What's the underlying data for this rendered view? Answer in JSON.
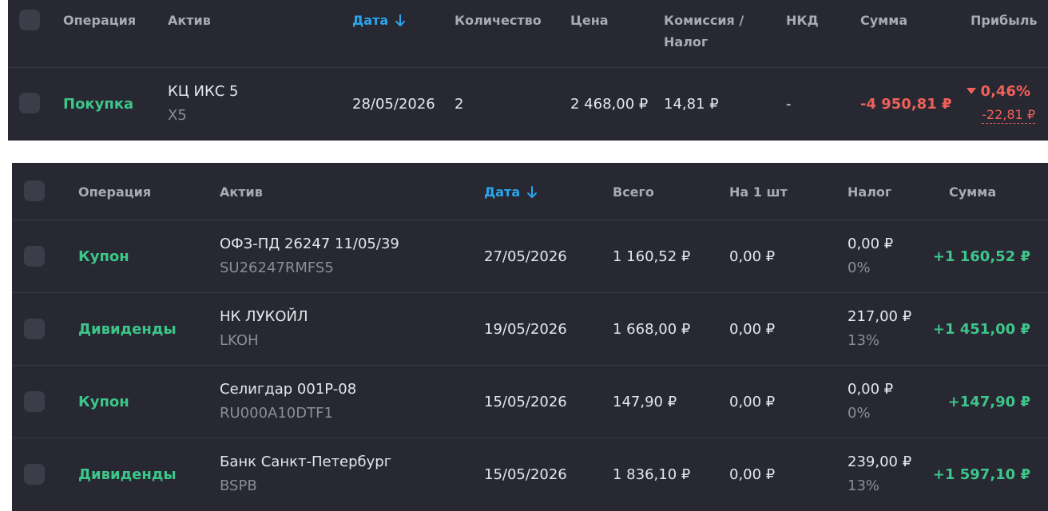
{
  "trades": {
    "headers": {
      "operation": "Операция",
      "asset": "Актив",
      "date": "Дата",
      "quantity": "Количество",
      "price": "Цена",
      "commission_line1": "Комиссия /",
      "commission_line2": "Налог",
      "nkd": "НКД",
      "sum": "Сумма",
      "profit": "Прибыль"
    },
    "rows": [
      {
        "operation": "Покупка",
        "asset_name": "КЦ ИКС 5",
        "asset_ticker": "X5",
        "date": "28/05/2026",
        "quantity": "2",
        "price": "2 468,00 ₽",
        "commission": "14,81 ₽",
        "nkd": "-",
        "sum": "-4 950,81 ₽",
        "profit_percent": "0,46%",
        "profit_amount": "-22,81 ₽"
      }
    ]
  },
  "payouts": {
    "headers": {
      "operation": "Операция",
      "asset": "Актив",
      "date": "Дата",
      "total": "Всего",
      "per_share": "На 1 шт",
      "tax": "Налог",
      "sum": "Сумма"
    },
    "rows": [
      {
        "operation": "Купон",
        "asset_name": "ОФЗ-ПД 26247 11/05/39",
        "asset_ticker": "SU26247RMFS5",
        "date": "27/05/2026",
        "total": "1 160,52 ₽",
        "per_share": "0,00 ₽",
        "tax": "0,00 ₽",
        "tax_rate": "0%",
        "sum": "+1 160,52 ₽"
      },
      {
        "operation": "Дивиденды",
        "asset_name": "НК ЛУКОЙЛ",
        "asset_ticker": "LKOH",
        "date": "19/05/2026",
        "total": "1 668,00 ₽",
        "per_share": "0,00 ₽",
        "tax": "217,00 ₽",
        "tax_rate": "13%",
        "sum": "+1 451,00 ₽"
      },
      {
        "operation": "Купон",
        "asset_name": "Селигдар 001P-08",
        "asset_ticker": "RU000A10DTF1",
        "date": "15/05/2026",
        "total": "147,90 ₽",
        "per_share": "0,00 ₽",
        "tax": "0,00 ₽",
        "tax_rate": "0%",
        "sum": "+147,90 ₽"
      },
      {
        "operation": "Дивиденды",
        "asset_name": "Банк Санкт-Петербург",
        "asset_ticker": "BSPB",
        "date": "15/05/2026",
        "total": "1 836,10 ₽",
        "per_share": "0,00 ₽",
        "tax": "239,00 ₽",
        "tax_rate": "13%",
        "sum": "+1 597,10 ₽"
      }
    ]
  },
  "colors": {
    "panel_bg": "#272831",
    "positive": "#3dc58a",
    "negative": "#f0605a",
    "active_sort": "#2aa6ee"
  },
  "icons": {
    "sort": "arrow-down-icon",
    "profit_trend": "caret-down-icon"
  }
}
